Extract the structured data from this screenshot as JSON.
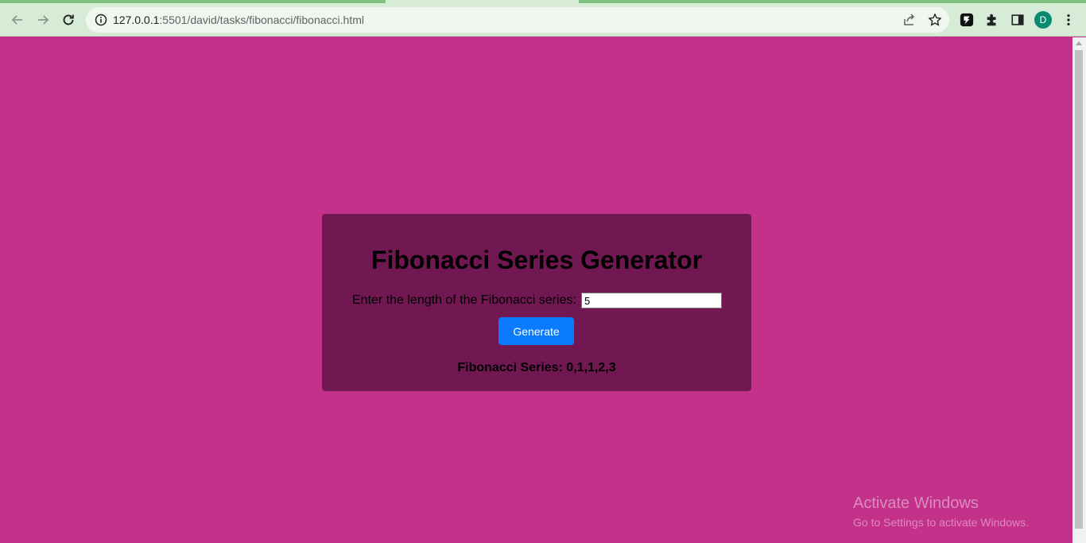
{
  "browser": {
    "url_host": "127.0.0.1",
    "url_rest": ":5501/david/tasks/fibonacci/fibonacci.html",
    "profile_initial": "D",
    "icons": {
      "back": "back-arrow-icon",
      "forward": "forward-arrow-icon",
      "reload": "reload-icon",
      "site_info": "info-icon",
      "share": "share-icon",
      "bookmark": "star-icon",
      "extension_app": "app-extension-icon",
      "extensions": "puzzle-icon",
      "side_panel": "side-panel-icon",
      "menu": "kebab-menu-icon"
    }
  },
  "page": {
    "title": "Fibonacci Series Generator",
    "input_label": "Enter the length of the Fibonacci series:",
    "input_value": "5",
    "button_label": "Generate",
    "result_text": "Fibonacci Series: 0,1,1,2,3"
  },
  "watermark": {
    "title": "Activate Windows",
    "subtitle": "Go to Settings to activate Windows."
  },
  "colors": {
    "page_background": "#c4318a",
    "card_background": "#711852",
    "button_background": "#0a7bff",
    "browser_chrome": "#d7ecd6",
    "avatar": "#0b8a72"
  }
}
